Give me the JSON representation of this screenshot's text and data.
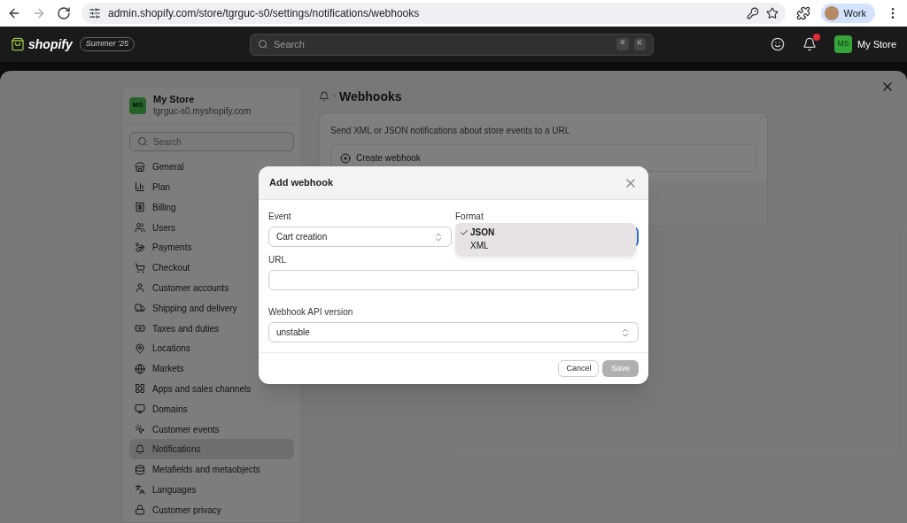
{
  "browser": {
    "url": "admin.shopify.com/store/tgrguc-s0/settings/notifications/webhooks",
    "profile": "Work"
  },
  "topbar": {
    "brand": "shopify",
    "edition": "Summer '25",
    "search_placeholder": "Search",
    "shortcut": [
      "⌘",
      "K"
    ],
    "store": {
      "initials": "MS",
      "name": "My Store"
    }
  },
  "sidebar": {
    "store": {
      "initials": "MS",
      "name": "My Store",
      "domain": "tgrguc-s0.myshopify.com"
    },
    "search_placeholder": "Search",
    "items": [
      {
        "label": "General",
        "selected": false
      },
      {
        "label": "Plan",
        "selected": false
      },
      {
        "label": "Billing",
        "selected": false
      },
      {
        "label": "Users",
        "selected": false
      },
      {
        "label": "Payments",
        "selected": false
      },
      {
        "label": "Checkout",
        "selected": false
      },
      {
        "label": "Customer accounts",
        "selected": false
      },
      {
        "label": "Shipping and delivery",
        "selected": false
      },
      {
        "label": "Taxes and duties",
        "selected": false
      },
      {
        "label": "Locations",
        "selected": false
      },
      {
        "label": "Markets",
        "selected": false
      },
      {
        "label": "Apps and sales channels",
        "selected": false
      },
      {
        "label": "Domains",
        "selected": false
      },
      {
        "label": "Customer events",
        "selected": false
      },
      {
        "label": "Notifications",
        "selected": true
      },
      {
        "label": "Metafields and metaobjects",
        "selected": false
      },
      {
        "label": "Languages",
        "selected": false
      },
      {
        "label": "Customer privacy",
        "selected": false
      }
    ]
  },
  "page": {
    "separator": "›",
    "title": "Webhooks",
    "description": "Send XML or JSON notifications about store events to a URL",
    "create_button": "Create webhook"
  },
  "modal": {
    "title": "Add webhook",
    "event": {
      "label": "Event",
      "value": "Cart creation"
    },
    "format": {
      "label": "Format",
      "options": [
        {
          "label": "JSON",
          "selected": true
        },
        {
          "label": "XML",
          "selected": false
        }
      ]
    },
    "url": {
      "label": "URL"
    },
    "api_version": {
      "label": "Webhook API version",
      "value": "unstable"
    },
    "cancel": "Cancel",
    "save": {
      "label": "Save",
      "disabled": true
    }
  }
}
